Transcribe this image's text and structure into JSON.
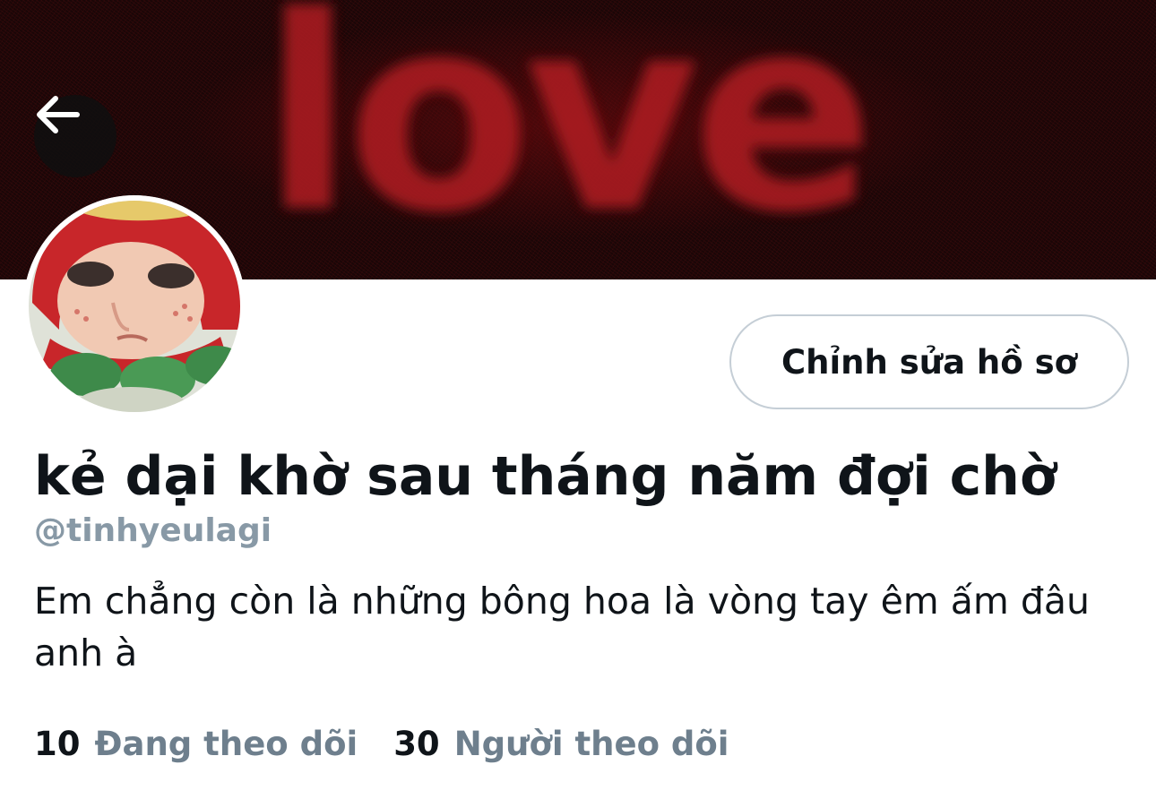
{
  "header": {
    "banner_word": "love",
    "back_icon": "arrow-left-icon"
  },
  "profile": {
    "edit_label": "Chỉnh sửa hồ sơ",
    "display_name": "kẻ dại khờ sau tháng năm đợi chờ",
    "handle": "@tinhyeulagi",
    "bio": "Em chẳng còn là những bông hoa là vòng tay êm ấm đâu anh à"
  },
  "stats": {
    "following_count": "10",
    "following_label": "Đang theo dõi",
    "followers_count": "30",
    "followers_label": "Người theo dõi"
  },
  "colors": {
    "text": "#0f1419",
    "muted": "#6e7f8d",
    "banner_red": "#b01d22",
    "banner_dark": "#1a0607",
    "button_border": "#c5ced6"
  }
}
